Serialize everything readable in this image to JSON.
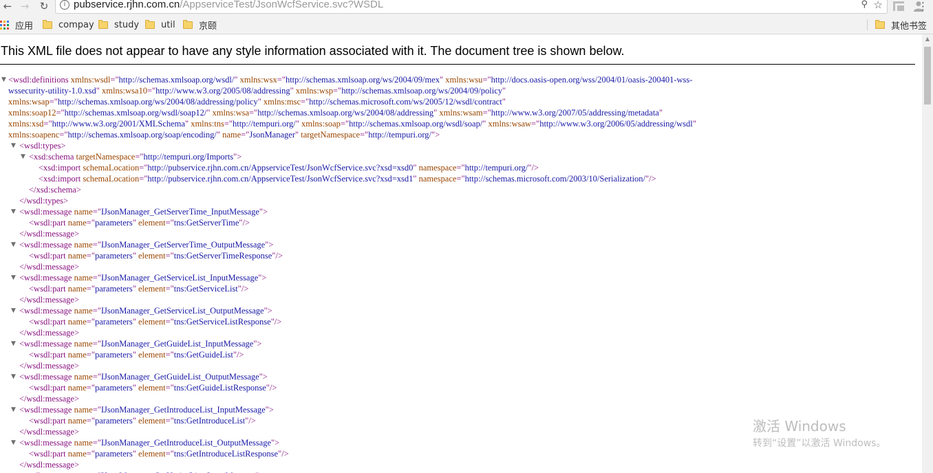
{
  "browser": {
    "url_host": "pubservice.rjhn.com.cn",
    "url_path": "/AppserviceTest/JsonWcfService.svc?WSDL",
    "bookmarks": [
      "应用",
      "compay",
      "study",
      "util",
      "京颐"
    ],
    "other_bookmarks": "其他书签"
  },
  "page": {
    "notice": "This XML file does not appear to have any style information associated with it. The document tree is shown below."
  },
  "tree": {
    "lines": [
      [
        {
          "t": "<wsdl:definitions "
        },
        {
          "a": "xmlns:wsdl"
        },
        {
          "t": "=\""
        },
        {
          "v": "http://schemas.xmlsoap.org/wsdl/"
        },
        {
          "t": "\" "
        },
        {
          "a": "xmlns:wsx"
        },
        {
          "t": "=\""
        },
        {
          "v": "http://schemas.xmlsoap.org/ws/2004/09/mex"
        },
        {
          "t": "\" "
        },
        {
          "a": "xmlns:wsu"
        },
        {
          "t": "=\""
        },
        {
          "v": "http://docs.oasis-open.org/wss/2004/01/oasis-200401-wss-"
        }
      ],
      [
        {
          "v": "wssecurity-utility-1.0.xsd"
        },
        {
          "t": "\" "
        },
        {
          "a": "xmlns:wsa10"
        },
        {
          "t": "=\""
        },
        {
          "v": "http://www.w3.org/2005/08/addressing"
        },
        {
          "t": "\" "
        },
        {
          "a": "xmlns:wsp"
        },
        {
          "t": "=\""
        },
        {
          "v": "http://schemas.xmlsoap.org/ws/2004/09/policy"
        },
        {
          "t": "\""
        }
      ],
      [
        {
          "a": "xmlns:wsap"
        },
        {
          "t": "=\""
        },
        {
          "v": "http://schemas.xmlsoap.org/ws/2004/08/addressing/policy"
        },
        {
          "t": "\" "
        },
        {
          "a": "xmlns:msc"
        },
        {
          "t": "=\""
        },
        {
          "v": "http://schemas.microsoft.com/ws/2005/12/wsdl/contract"
        },
        {
          "t": "\""
        }
      ],
      [
        {
          "a": "xmlns:soap12"
        },
        {
          "t": "=\""
        },
        {
          "v": "http://schemas.xmlsoap.org/wsdl/soap12/"
        },
        {
          "t": "\" "
        },
        {
          "a": "xmlns:wsa"
        },
        {
          "t": "=\""
        },
        {
          "v": "http://schemas.xmlsoap.org/ws/2004/08/addressing"
        },
        {
          "t": "\" "
        },
        {
          "a": "xmlns:wsam"
        },
        {
          "t": "=\""
        },
        {
          "v": "http://www.w3.org/2007/05/addressing/metadata"
        },
        {
          "t": "\""
        }
      ],
      [
        {
          "a": "xmlns:xsd"
        },
        {
          "t": "=\""
        },
        {
          "v": "http://www.w3.org/2001/XMLSchema"
        },
        {
          "t": "\" "
        },
        {
          "a": "xmlns:tns"
        },
        {
          "t": "=\""
        },
        {
          "v": "http://tempuri.org/"
        },
        {
          "t": "\" "
        },
        {
          "a": "xmlns:soap"
        },
        {
          "t": "=\""
        },
        {
          "v": "http://schemas.xmlsoap.org/wsdl/soap/"
        },
        {
          "t": "\" "
        },
        {
          "a": "xmlns:wsaw"
        },
        {
          "t": "=\""
        },
        {
          "v": "http://www.w3.org/2006/05/addressing/wsdl"
        },
        {
          "t": "\""
        }
      ],
      [
        {
          "a": "xmlns:soapenc"
        },
        {
          "t": "=\""
        },
        {
          "v": "http://schemas.xmlsoap.org/soap/encoding/"
        },
        {
          "t": "\" "
        },
        {
          "a": "name"
        },
        {
          "t": "=\""
        },
        {
          "v": "JsonManager"
        },
        {
          "t": "\" "
        },
        {
          "a": "targetNamespace"
        },
        {
          "t": "=\""
        },
        {
          "v": "http://tempuri.org/"
        },
        {
          "t": "\">"
        }
      ],
      [
        {
          "t": "<wsdl:types>"
        }
      ],
      [
        {
          "t": "<xsd:schema "
        },
        {
          "a": "targetNamespace"
        },
        {
          "t": "=\""
        },
        {
          "v": "http://tempuri.org/Imports"
        },
        {
          "t": "\">"
        }
      ],
      [
        {
          "t": "<xsd:import "
        },
        {
          "a": "schemaLocation"
        },
        {
          "t": "=\""
        },
        {
          "v": "http://pubservice.rjhn.com.cn/AppserviceTest/JsonWcfService.svc?xsd=xsd0"
        },
        {
          "t": "\" "
        },
        {
          "a": "namespace"
        },
        {
          "t": "=\""
        },
        {
          "v": "http://tempuri.org/"
        },
        {
          "t": "\"/>"
        }
      ],
      [
        {
          "t": "<xsd:import "
        },
        {
          "a": "schemaLocation"
        },
        {
          "t": "=\""
        },
        {
          "v": "http://pubservice.rjhn.com.cn/AppserviceTest/JsonWcfService.svc?xsd=xsd1"
        },
        {
          "t": "\" "
        },
        {
          "a": "namespace"
        },
        {
          "t": "=\""
        },
        {
          "v": "http://schemas.microsoft.com/2003/10/Serialization/"
        },
        {
          "t": "\"/>"
        }
      ],
      [
        {
          "t": "</xsd:schema>"
        }
      ],
      [
        {
          "t": "</wsdl:types>"
        }
      ],
      [
        {
          "t": "<wsdl:message "
        },
        {
          "a": "name"
        },
        {
          "t": "=\""
        },
        {
          "v": "IJsonManager_GetServerTime_InputMessage"
        },
        {
          "t": "\">"
        }
      ],
      [
        {
          "t": "<wsdl:part "
        },
        {
          "a": "name"
        },
        {
          "t": "=\""
        },
        {
          "v": "parameters"
        },
        {
          "t": "\" "
        },
        {
          "a": "element"
        },
        {
          "t": "=\""
        },
        {
          "v": "tns:GetServerTime"
        },
        {
          "t": "\"/>"
        }
      ],
      [
        {
          "t": "</wsdl:message>"
        }
      ],
      [
        {
          "t": "<wsdl:message "
        },
        {
          "a": "name"
        },
        {
          "t": "=\""
        },
        {
          "v": "IJsonManager_GetServerTime_OutputMessage"
        },
        {
          "t": "\">"
        }
      ],
      [
        {
          "t": "<wsdl:part "
        },
        {
          "a": "name"
        },
        {
          "t": "=\""
        },
        {
          "v": "parameters"
        },
        {
          "t": "\" "
        },
        {
          "a": "element"
        },
        {
          "t": "=\""
        },
        {
          "v": "tns:GetServerTimeResponse"
        },
        {
          "t": "\"/>"
        }
      ],
      [
        {
          "t": "</wsdl:message>"
        }
      ],
      [
        {
          "t": "<wsdl:message "
        },
        {
          "a": "name"
        },
        {
          "t": "=\""
        },
        {
          "v": "IJsonManager_GetServiceList_InputMessage"
        },
        {
          "t": "\">"
        }
      ],
      [
        {
          "t": "<wsdl:part "
        },
        {
          "a": "name"
        },
        {
          "t": "=\""
        },
        {
          "v": "parameters"
        },
        {
          "t": "\" "
        },
        {
          "a": "element"
        },
        {
          "t": "=\""
        },
        {
          "v": "tns:GetServiceList"
        },
        {
          "t": "\"/>"
        }
      ],
      [
        {
          "t": "</wsdl:message>"
        }
      ],
      [
        {
          "t": "<wsdl:message "
        },
        {
          "a": "name"
        },
        {
          "t": "=\""
        },
        {
          "v": "IJsonManager_GetServiceList_OutputMessage"
        },
        {
          "t": "\">"
        }
      ],
      [
        {
          "t": "<wsdl:part "
        },
        {
          "a": "name"
        },
        {
          "t": "=\""
        },
        {
          "v": "parameters"
        },
        {
          "t": "\" "
        },
        {
          "a": "element"
        },
        {
          "t": "=\""
        },
        {
          "v": "tns:GetServiceListResponse"
        },
        {
          "t": "\"/>"
        }
      ],
      [
        {
          "t": "</wsdl:message>"
        }
      ],
      [
        {
          "t": "<wsdl:message "
        },
        {
          "a": "name"
        },
        {
          "t": "=\""
        },
        {
          "v": "IJsonManager_GetGuideList_InputMessage"
        },
        {
          "t": "\">"
        }
      ],
      [
        {
          "t": "<wsdl:part "
        },
        {
          "a": "name"
        },
        {
          "t": "=\""
        },
        {
          "v": "parameters"
        },
        {
          "t": "\" "
        },
        {
          "a": "element"
        },
        {
          "t": "=\""
        },
        {
          "v": "tns:GetGuideList"
        },
        {
          "t": "\"/>"
        }
      ],
      [
        {
          "t": "</wsdl:message>"
        }
      ],
      [
        {
          "t": "<wsdl:message "
        },
        {
          "a": "name"
        },
        {
          "t": "=\""
        },
        {
          "v": "IJsonManager_GetGuideList_OutputMessage"
        },
        {
          "t": "\">"
        }
      ],
      [
        {
          "t": "<wsdl:part "
        },
        {
          "a": "name"
        },
        {
          "t": "=\""
        },
        {
          "v": "parameters"
        },
        {
          "t": "\" "
        },
        {
          "a": "element"
        },
        {
          "t": "=\""
        },
        {
          "v": "tns:GetGuideListResponse"
        },
        {
          "t": "\"/>"
        }
      ],
      [
        {
          "t": "</wsdl:message>"
        }
      ],
      [
        {
          "t": "<wsdl:message "
        },
        {
          "a": "name"
        },
        {
          "t": "=\""
        },
        {
          "v": "IJsonManager_GetIntroduceList_InputMessage"
        },
        {
          "t": "\">"
        }
      ],
      [
        {
          "t": "<wsdl:part "
        },
        {
          "a": "name"
        },
        {
          "t": "=\""
        },
        {
          "v": "parameters"
        },
        {
          "t": "\" "
        },
        {
          "a": "element"
        },
        {
          "t": "=\""
        },
        {
          "v": "tns:GetIntroduceList"
        },
        {
          "t": "\"/>"
        }
      ],
      [
        {
          "t": "</wsdl:message>"
        }
      ],
      [
        {
          "t": "<wsdl:message "
        },
        {
          "a": "name"
        },
        {
          "t": "=\""
        },
        {
          "v": "IJsonManager_GetIntroduceList_OutputMessage"
        },
        {
          "t": "\">"
        }
      ],
      [
        {
          "t": "<wsdl:part "
        },
        {
          "a": "name"
        },
        {
          "t": "=\""
        },
        {
          "v": "parameters"
        },
        {
          "t": "\" "
        },
        {
          "a": "element"
        },
        {
          "t": "=\""
        },
        {
          "v": "tns:GetIntroduceListResponse"
        },
        {
          "t": "\"/>"
        }
      ],
      [
        {
          "t": "</wsdl:message>"
        }
      ],
      [
        {
          "t": "<wsdl:message "
        },
        {
          "a": "name"
        },
        {
          "t": "=\""
        },
        {
          "v": "IJsonManager_GetNoticeList_InputMessage"
        },
        {
          "t": "\">"
        }
      ]
    ]
  },
  "watermark": {
    "title": "激活 Windows",
    "subtitle": "转到“设置”以激活 Windows。"
  },
  "colors": {
    "tag": "#881280",
    "attr_name": "#994500",
    "attr_value": "#1a1aa6",
    "bookmark_folder": "#f7d46a"
  }
}
